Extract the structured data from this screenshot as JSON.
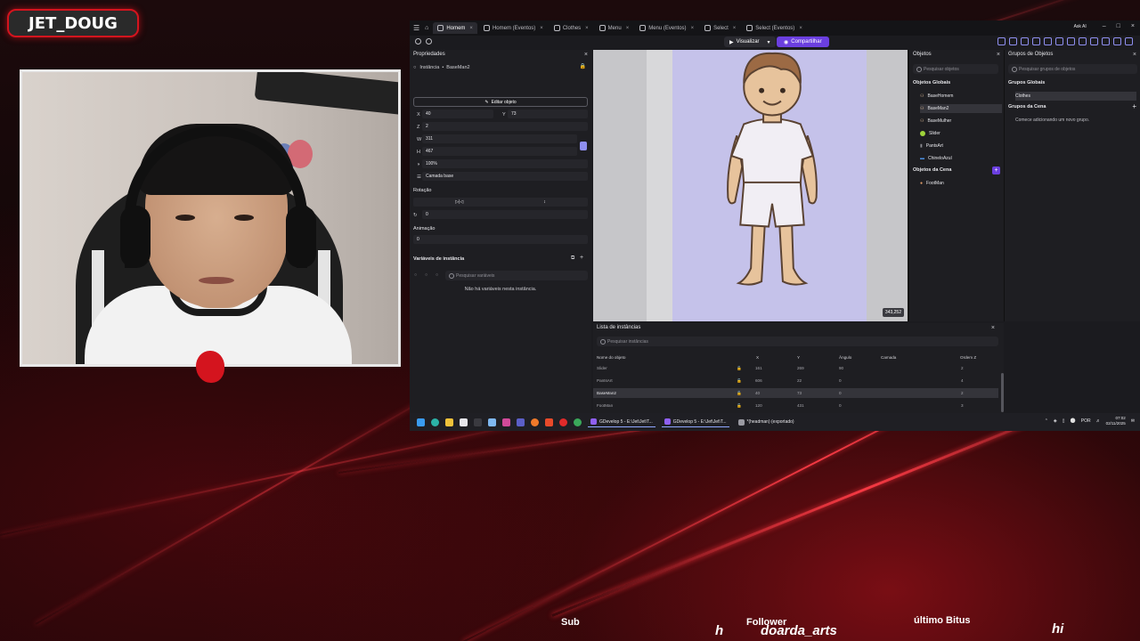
{
  "overlay": {
    "streamer_name": "JET_DOUG",
    "ticker": {
      "sub_label": "Sub",
      "sub_value": "h",
      "follower_label": "Follower",
      "follower_value": "doarda_arts",
      "bits_label": "último Bitus",
      "bits_value": "hi"
    },
    "accent_color": "#d4141e"
  },
  "app": {
    "tabs": [
      {
        "label": "Homem",
        "active": true
      },
      {
        "label": "Homem (Eventos)"
      },
      {
        "label": "Clothes"
      },
      {
        "label": "Menu"
      },
      {
        "label": "Menu (Eventos)"
      },
      {
        "label": "Select"
      },
      {
        "label": "Select (Eventos)"
      }
    ],
    "ask_ai": "Ask AI",
    "preview_label": "Visualizar",
    "share_label": "Compartilhar",
    "accent_color": "#6b3fe0"
  },
  "properties": {
    "title": "Propriedades",
    "instance_label": "Instância",
    "instance_name": "BaseMan2",
    "edit_object": "Editar objeto",
    "x_label": "X",
    "x_value": "40",
    "y_label": "Y",
    "y_value": "73",
    "z_label": "Z",
    "z_value": "2",
    "w_label": "W",
    "w_value": "311",
    "h_label": "H",
    "h_value": "467",
    "opacity_value": "100%",
    "layer_value": "Camada base",
    "rotation_label": "Rotação",
    "flip_label": "▷|◁",
    "angle_value": "0",
    "animation_label": "Animação",
    "animation_value": "0",
    "variables_title": "Variáveis de instância",
    "variables_search_placeholder": "Pesquisar variáveis",
    "variables_empty": "Não há variáveis nesta instância."
  },
  "canvas": {
    "coords": "343,252"
  },
  "objects": {
    "title": "Objetos",
    "search_placeholder": "Pesquisar objetos",
    "global_title": "Objetos Globais",
    "global_items": [
      {
        "name": "BaseHomem",
        "icon": "person-icon"
      },
      {
        "name": "BaseMan2",
        "icon": "person-icon",
        "selected": true
      },
      {
        "name": "BaseMulher",
        "icon": "person-icon"
      },
      {
        "name": "Slider",
        "icon": "slider-icon"
      },
      {
        "name": "PantsArt",
        "icon": "pants-icon"
      },
      {
        "name": "ChineloAzul",
        "icon": "sandal-icon"
      }
    ],
    "scene_title": "Objetos da Cena",
    "scene_items": [
      {
        "name": "FootMan",
        "icon": "foot-icon"
      }
    ]
  },
  "groups": {
    "title": "Grupos de Objetos",
    "search_placeholder": "Pesquisar grupos de objetos",
    "global_title": "Grupos Globais",
    "global_items": [
      "Clothes"
    ],
    "scene_title": "Grupos da Cena",
    "scene_empty": "Comece adicionando um novo grupo."
  },
  "instances": {
    "title": "Lista de instâncias",
    "search_placeholder": "Pesquisar instâncias",
    "columns": [
      "Nome do objeto",
      "X",
      "Y",
      "Ângulo",
      "Camada",
      "Ordem Z"
    ],
    "rows": [
      {
        "name": "Slider",
        "x": "161",
        "y": "269",
        "angle": "90",
        "layer": "",
        "z": "2"
      },
      {
        "name": "PantsArt",
        "x": "606",
        "y": "22",
        "angle": "0",
        "layer": "",
        "z": "4"
      },
      {
        "name": "BaseMan2",
        "x": "40",
        "y": "73",
        "angle": "0",
        "layer": "",
        "z": "2",
        "selected": true
      },
      {
        "name": "FootMan",
        "x": "120",
        "y": "431",
        "angle": "0",
        "layer": "",
        "z": "3"
      }
    ]
  },
  "taskbar": {
    "apps": [
      "GDevelop 5 - E:\\Jet\\Jet\\T...",
      "GDevelop 5 - E:\\Jet\\Jet\\T...",
      "*(headman) (exportado)"
    ],
    "lang": "POR",
    "time": "07:02",
    "date": "02/11/2025"
  }
}
